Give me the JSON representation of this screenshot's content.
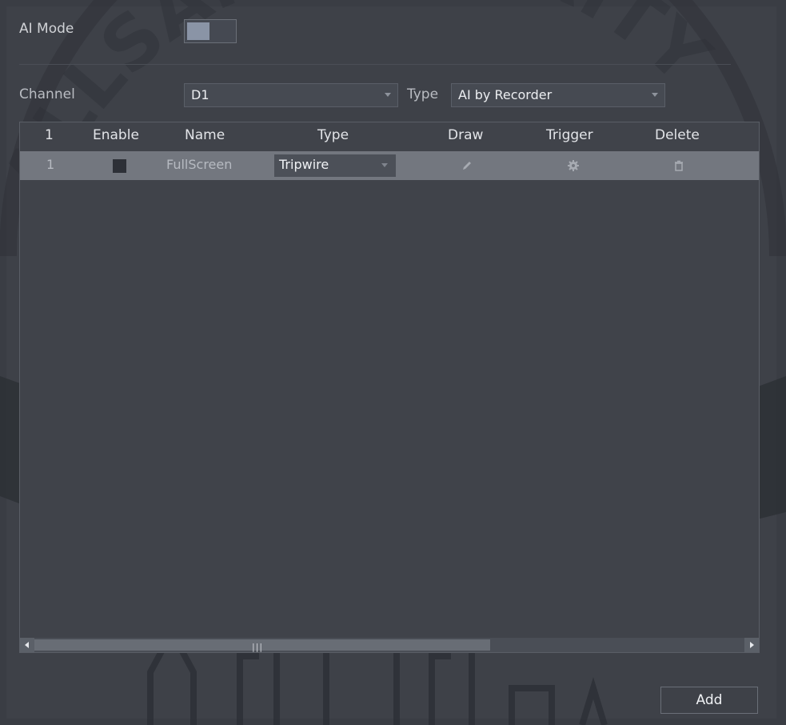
{
  "ai_mode": {
    "label": "AI Mode",
    "enabled": false
  },
  "filters": {
    "channel_label": "Channel",
    "channel_value": "D1",
    "type_label": "Type",
    "type_value": "AI by Recorder"
  },
  "table": {
    "headers": [
      "1",
      "Enable",
      "Name",
      "Type",
      "Draw",
      "Trigger",
      "Delete"
    ],
    "rows": [
      {
        "index": "1",
        "enable": false,
        "name": "FullScreen",
        "type": "Tripwire",
        "draw_icon": "pencil-icon",
        "trigger_icon": "gear-icon",
        "delete_icon": "trash-icon"
      }
    ]
  },
  "actions": {
    "add_label": "Add"
  },
  "watermark": {
    "text": "ALLSAM SECURITY"
  }
}
